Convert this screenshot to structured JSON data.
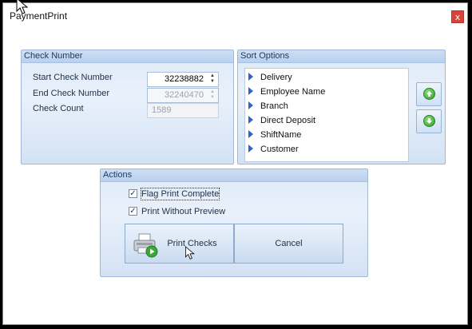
{
  "window": {
    "title": "PaymentPrint",
    "close_label": "x"
  },
  "check_number": {
    "header": "Check Number",
    "start_label": "Start Check Number",
    "start_value": "32238882",
    "end_label": "End Check Number",
    "end_value": "32240470",
    "count_label": "Check Count",
    "count_value": "1589"
  },
  "sort_options": {
    "header": "Sort Options",
    "items": [
      "Delivery",
      "Employee Name",
      "Branch",
      "Direct Deposit",
      "ShiftName",
      "Customer"
    ]
  },
  "actions": {
    "header": "Actions",
    "flag_print_complete": "Flag Print Complete",
    "print_without_preview": "Print Without Preview",
    "print_checks": "Print Checks",
    "cancel": "Cancel"
  },
  "icons": {
    "move_up": "arrow-up-circle-icon",
    "move_down": "arrow-down-circle-icon",
    "printer": "printer-icon"
  },
  "colors": {
    "close": "#d9433a",
    "group_header": "#b9d0ee",
    "list_arrow": "#2f63c7"
  }
}
